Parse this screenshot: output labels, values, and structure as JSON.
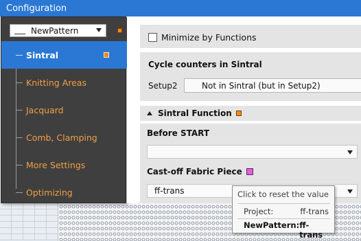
{
  "window": {
    "title": "Configuration"
  },
  "pattern": {
    "selected": "NewPattern",
    "marker_color": "#f0891c"
  },
  "sidebar": {
    "items": [
      {
        "label": "Sintral",
        "active": true,
        "has_marker": true
      },
      {
        "label": "Knitting Areas",
        "active": false
      },
      {
        "label": "Jacquard",
        "active": false
      },
      {
        "label": "Comb, Clamping",
        "active": false
      },
      {
        "label": "More Settings",
        "active": false
      },
      {
        "label": "Optimizing",
        "active": false
      }
    ]
  },
  "options": {
    "minimize_label": "Minimize by Functions",
    "minimize_checked": false
  },
  "cycle": {
    "title": "Cycle counters in Sintral",
    "setup_label": "Setup2",
    "setup_value": "Not in Sintral (but in Setup2)"
  },
  "sintral_function": {
    "title": "Sintral Function",
    "before_start_label": "Before START",
    "before_start_value": "",
    "castoff_label": "Cast-off Fabric Piece",
    "castoff_value": "ff-trans",
    "castoff_marker_color": "#d765d4"
  },
  "tooltip": {
    "title": "Click to reset the value",
    "project_label": "Project:",
    "project_value": "ff-trans",
    "pattern_label": "NewPattern:",
    "pattern_value": "ff-trans"
  },
  "colors": {
    "accent": "#2b78d4",
    "nav_text": "#f0a044",
    "panel_bg": "#3f3f3f"
  }
}
